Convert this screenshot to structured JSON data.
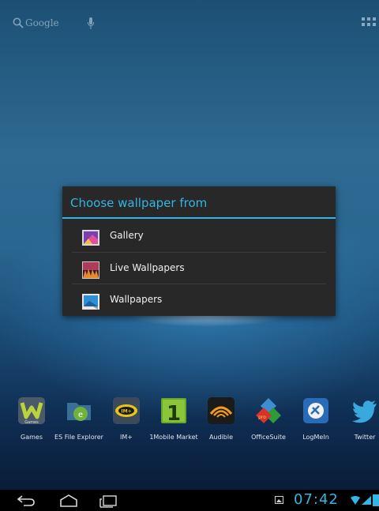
{
  "search": {
    "label": "Google"
  },
  "dialog": {
    "title": "Choose wallpaper from",
    "options": [
      {
        "label": "Gallery"
      },
      {
        "label": "Live Wallpapers"
      },
      {
        "label": "Wallpapers"
      }
    ]
  },
  "dock": {
    "apps": [
      {
        "label": "Games",
        "badge": "Games"
      },
      {
        "label": "ES File Explorer"
      },
      {
        "label": "IM+",
        "badge": "IM+"
      },
      {
        "label": "1Mobile Market",
        "badge": "1"
      },
      {
        "label": "Audible"
      },
      {
        "label": "OfficeSuite",
        "badge": "pro"
      },
      {
        "label": "LogMeIn"
      },
      {
        "label": "Twitter"
      }
    ]
  },
  "status": {
    "time": "07:42"
  },
  "colors": {
    "accent": "#33b5e5",
    "dialog_bg": "#282828"
  }
}
